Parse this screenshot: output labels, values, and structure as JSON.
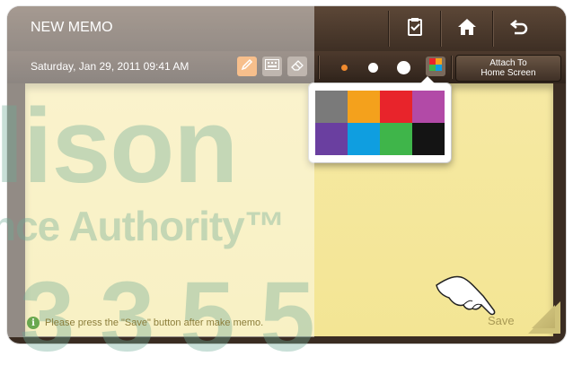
{
  "header": {
    "title": "NEW MEMO",
    "buttons": [
      {
        "name": "clipboard-icon"
      },
      {
        "name": "home-icon"
      },
      {
        "name": "back-icon"
      }
    ]
  },
  "toolbar": {
    "datetime": "Saturday, Jan 29, 2011 09:41 AM",
    "tools": [
      "pen-icon",
      "keyboard-icon",
      "eraser-icon"
    ],
    "pen_sizes": [
      "small",
      "medium",
      "large"
    ],
    "attach_label_line1": "Attach To",
    "attach_label_line2": "Home Screen"
  },
  "palette": {
    "colors": [
      "#7a7a7a",
      "#f4a11c",
      "#e8242b",
      "#b24aa7",
      "#6a3fa0",
      "#0f9ee0",
      "#3fb54a",
      "#141414"
    ]
  },
  "memo": {
    "hint": "Please press the \"Save\" button after make memo.",
    "save_label": "Save"
  },
  "watermark": {
    "line1": "lison",
    "line2": "nce Authority™",
    "line3": "3355"
  }
}
